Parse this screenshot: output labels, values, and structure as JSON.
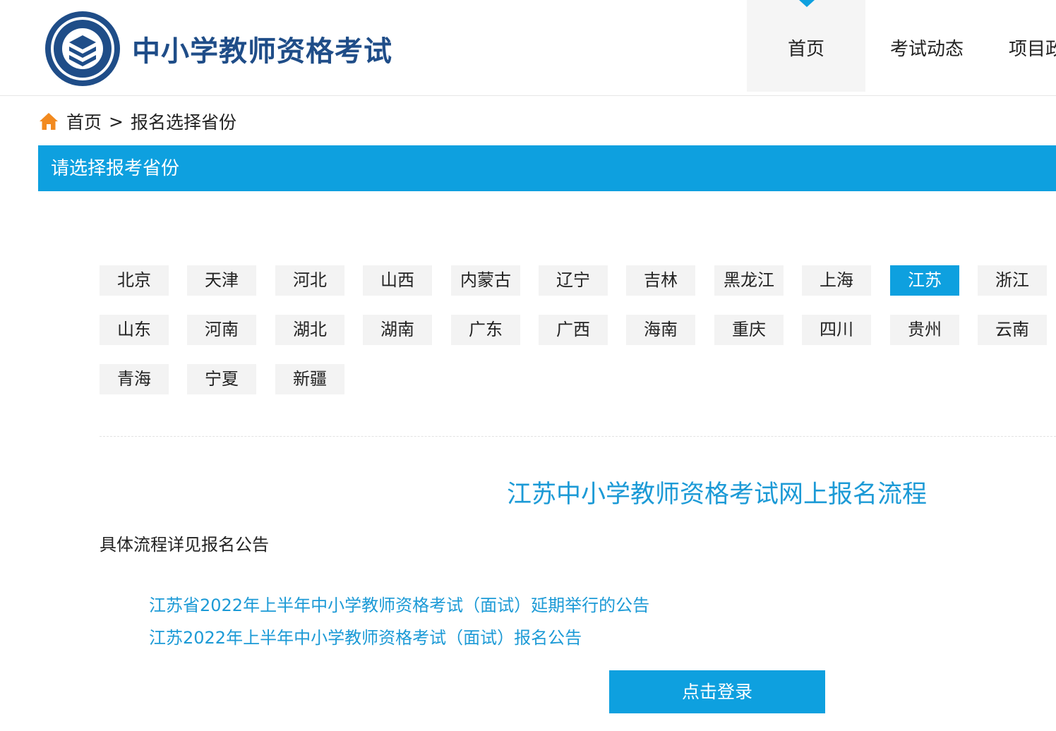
{
  "header": {
    "site_title": "中小学教师资格考试",
    "nav": [
      {
        "label": "首页"
      },
      {
        "label": "考试动态"
      },
      {
        "label": "项目政"
      }
    ]
  },
  "breadcrumb": {
    "home": "首页",
    "separator": ">",
    "current": "报名选择省份"
  },
  "section": {
    "title": "请选择报考省份"
  },
  "provinces": [
    "北京",
    "天津",
    "河北",
    "山西",
    "内蒙古",
    "辽宁",
    "吉林",
    "黑龙江",
    "上海",
    "江苏",
    "浙江",
    "山东",
    "河南",
    "湖北",
    "湖南",
    "广东",
    "广西",
    "海南",
    "重庆",
    "四川",
    "贵州",
    "云南",
    "青海",
    "宁夏",
    "新疆"
  ],
  "selected_province": "江苏",
  "flow": {
    "title": "江苏中小学教师资格考试网上报名流程",
    "desc": "具体流程详见报名公告",
    "notices": [
      "江苏省2022年上半年中小学教师资格考试（面试）延期举行的公告",
      "江苏2022年上半年中小学教师资格考试（面试）报名公告"
    ]
  },
  "login": {
    "label": "点击登录"
  },
  "colors": {
    "accent": "#0ea0df",
    "link": "#1c9ad6",
    "brand": "#1f4d88",
    "tile_bg": "#f3f3f3",
    "home_icon": "#f28a1f"
  }
}
